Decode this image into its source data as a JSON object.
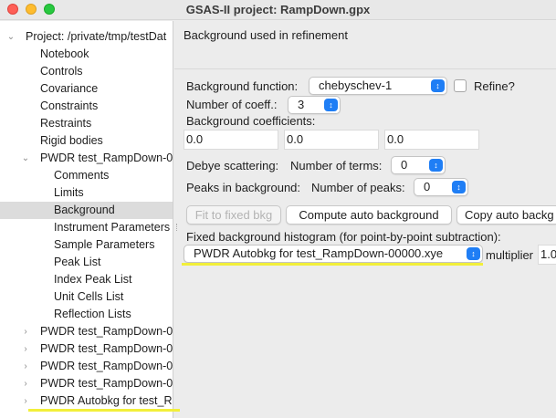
{
  "window": {
    "title": "GSAS-II project: RampDown.gpx"
  },
  "tree": {
    "root": "Project: /private/tmp/testDat",
    "items": [
      {
        "label": "Notebook"
      },
      {
        "label": "Controls"
      },
      {
        "label": "Covariance"
      },
      {
        "label": "Constraints"
      },
      {
        "label": "Restraints"
      },
      {
        "label": "Rigid bodies"
      },
      {
        "label": "PWDR test_RampDown-0"
      },
      {
        "label": "Comments"
      },
      {
        "label": "Limits"
      },
      {
        "label": "Background"
      },
      {
        "label": "Instrument Parameters"
      },
      {
        "label": "Sample Parameters"
      },
      {
        "label": "Peak List"
      },
      {
        "label": "Index Peak List"
      },
      {
        "label": "Unit Cells List"
      },
      {
        "label": "Reflection Lists"
      },
      {
        "label": "PWDR test_RampDown-0"
      },
      {
        "label": "PWDR test_RampDown-0"
      },
      {
        "label": "PWDR test_RampDown-0"
      },
      {
        "label": "PWDR test_RampDown-0"
      },
      {
        "label": "PWDR Autobkg for test_R"
      }
    ],
    "selected": "Background"
  },
  "panel": {
    "title": "Background used in refinement",
    "bg_function_label": "Background function:",
    "bg_function_value": "chebyschev-1",
    "refine_label": "Refine?",
    "num_coeff_label": "Number of coeff.:",
    "num_coeff_value": "3",
    "bg_coeff_label": "Background coefficients:",
    "coefficients": [
      "0.0",
      "0.0",
      "0.0"
    ],
    "debye_label": "Debye scattering:",
    "debye_terms_label": "Number of terms:",
    "debye_terms_value": "0",
    "peaks_label": "Peaks in background:",
    "peaks_count_label": "Number of peaks:",
    "peaks_count_value": "0",
    "fit_button": "Fit to fixed bkg",
    "compute_button": "Compute auto background",
    "copy_button": "Copy auto backg",
    "fixed_hist_label": "Fixed background histogram (for point-by-point subtraction):",
    "fixed_hist_value": "PWDR Autobkg for test_RampDown-00000.xye",
    "multiplier_label": "multiplier",
    "multiplier_value": "1.0",
    "highlight_color": "#f2ef3a",
    "accent_color": "#1f7ef5"
  }
}
